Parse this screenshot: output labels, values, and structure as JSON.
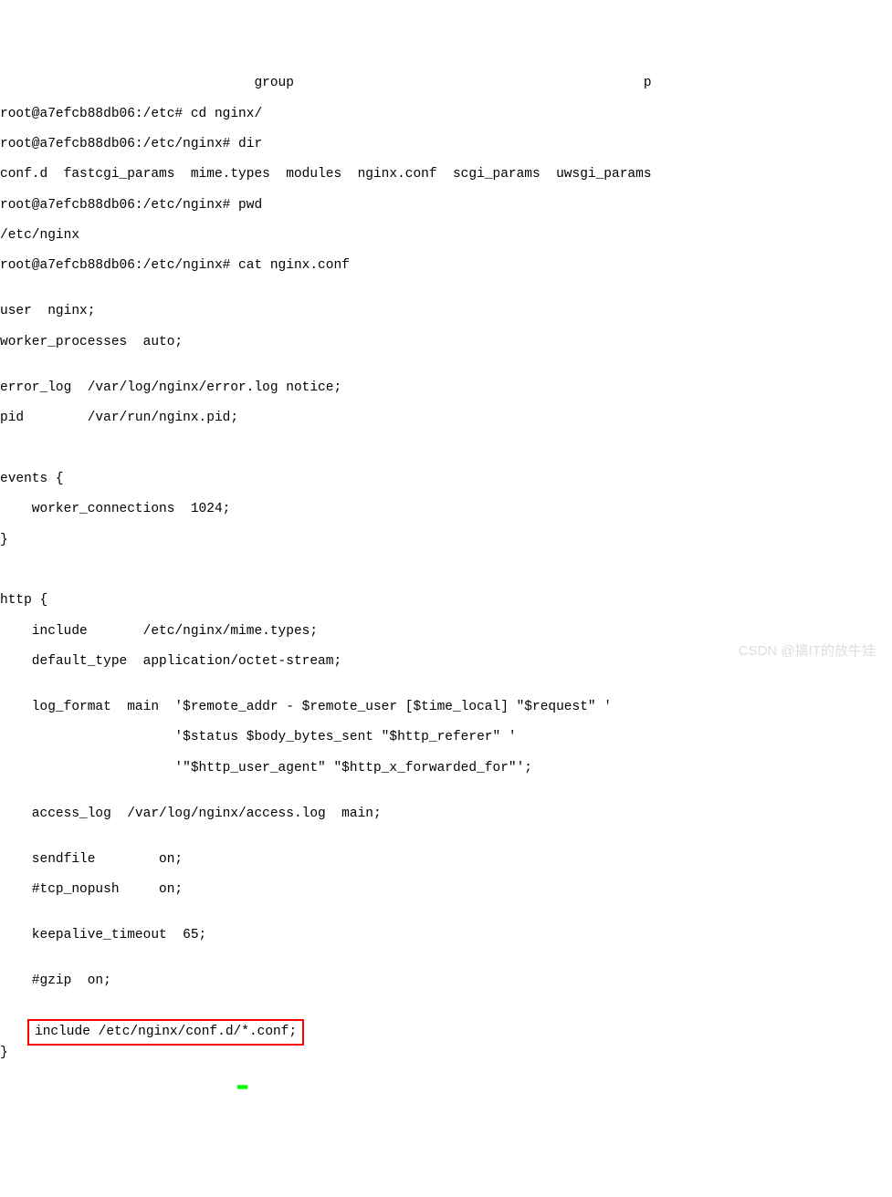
{
  "terminal": {
    "lines": {
      "l0": "                                group                                            p",
      "l1": "root@a7efcb88db06:/etc# cd nginx/",
      "l2": "root@a7efcb88db06:/etc/nginx# dir",
      "l3": "conf.d  fastcgi_params  mime.types  modules  nginx.conf  scgi_params  uwsgi_params",
      "l4": "root@a7efcb88db06:/etc/nginx# pwd",
      "l5": "/etc/nginx",
      "l6": "root@a7efcb88db06:/etc/nginx# cat nginx.conf",
      "l7": "",
      "l8": "user  nginx;",
      "l9": "worker_processes  auto;",
      "l10": "",
      "l11": "error_log  /var/log/nginx/error.log notice;",
      "l12": "pid        /var/run/nginx.pid;",
      "l13": "",
      "l14": "",
      "l15": "events {",
      "l16": "    worker_connections  1024;",
      "l17": "}",
      "l18": "",
      "l19": "",
      "l20": "http {",
      "l21": "    include       /etc/nginx/mime.types;",
      "l22": "    default_type  application/octet-stream;",
      "l23": "",
      "l24": "    log_format  main  '$remote_addr - $remote_user [$time_local] \"$request\" '",
      "l25": "                      '$status $body_bytes_sent \"$http_referer\" '",
      "l26": "                      '\"$http_user_agent\" \"$http_x_forwarded_for\"';",
      "l27": "",
      "l28": "    access_log  /var/log/nginx/access.log  main;",
      "l29": "",
      "l30": "    sendfile        on;",
      "l31": "    #tcp_nopush     on;",
      "l32": "",
      "l33": "    keepalive_timeout  65;",
      "l34": "",
      "l35": "    #gzip  on;",
      "l36": "",
      "highlighted": "include /etc/nginx/conf.d/*.conf;",
      "l38": "}"
    }
  },
  "cursor": "▂",
  "watermark": "CSDN @搞IT的放牛娃"
}
